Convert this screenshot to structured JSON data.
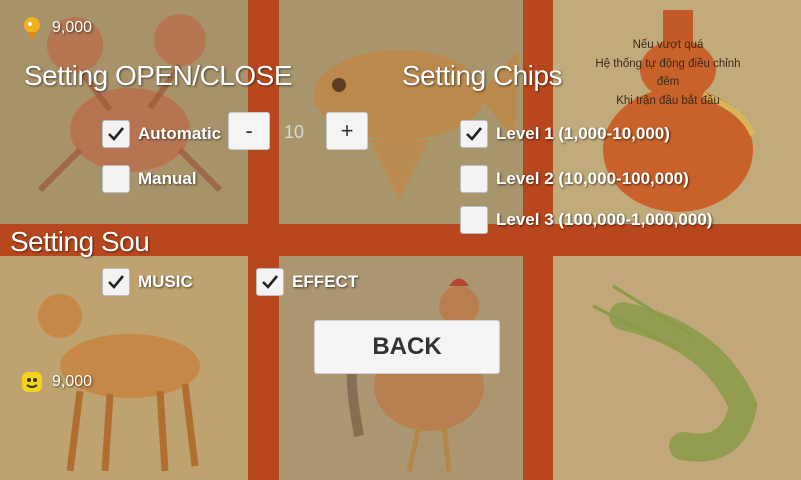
{
  "player_top": {
    "coins": "9,000"
  },
  "player_bottom": {
    "coins": "9,000"
  },
  "info_note": {
    "lines": [
      "Nếu vượt quá",
      "Hệ thống tự động điều chỉnh",
      "đêm",
      "Khi trận đầu bắt đầu"
    ]
  },
  "open_close": {
    "title": "Setting OPEN/CLOSE",
    "automatic_label": "Automatic",
    "automatic_checked": true,
    "manual_label": "Manual",
    "manual_checked": false,
    "stepper": {
      "minus": "-",
      "value": "10",
      "plus": "+"
    }
  },
  "chips": {
    "title": "Setting Chips",
    "levels": [
      {
        "label": "Level 1 (1,000-10,000)",
        "checked": true
      },
      {
        "label": "Level 2 (10,000-100,000)",
        "checked": false
      },
      {
        "label": "Level 3 (100,000-1,000,000)",
        "checked": false
      }
    ]
  },
  "sound": {
    "title": "Setting Sou",
    "music_label": "MUSIC",
    "music_checked": true,
    "effect_label": "EFFECT",
    "effect_checked": true
  },
  "back_label": "BACK",
  "board": {
    "tiles": [
      "crab-picture",
      "fish-picture",
      "gourd-picture",
      "deer-picture",
      "rooster-picture",
      "shrimp-picture"
    ],
    "accent": "#b8471d"
  }
}
